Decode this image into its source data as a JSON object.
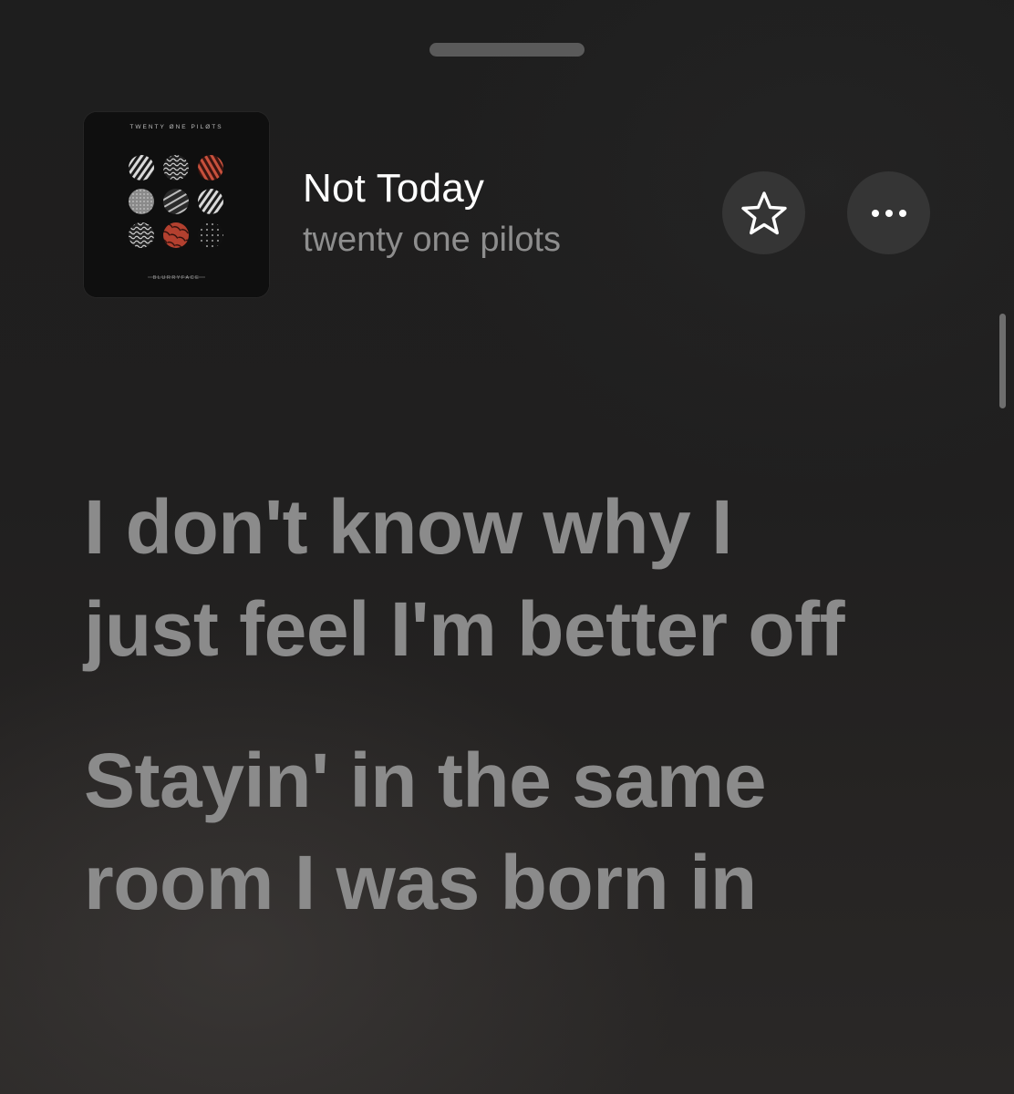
{
  "now_playing": {
    "title": "Not Today",
    "artist": "twenty one pilots",
    "artwork": {
      "band_text": "TWENTY ØNE PILØTS",
      "album_text": "BLURRYFACE"
    }
  },
  "actions": {
    "favorite_icon": "star-icon",
    "more_icon": "ellipsis-icon"
  },
  "lyrics": [
    "I don't know why I just feel I'm better off",
    "Stayin' in the same room I was born in"
  ],
  "colors": {
    "background": "#1c1b1b",
    "lyric_text": "#8b8b8b",
    "title_text": "#ffffff",
    "artist_text": "#8e8e8e",
    "button_bg": "#353535"
  }
}
